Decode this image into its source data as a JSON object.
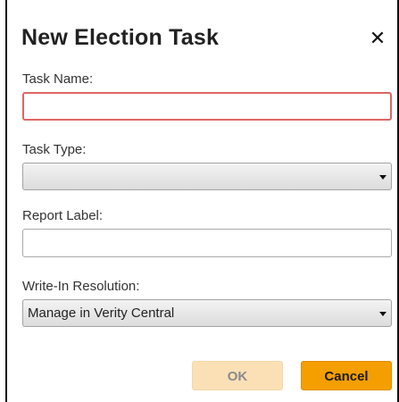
{
  "dialog": {
    "title": "New Election Task",
    "close_glyph": "✕",
    "close_icon": "close-icon"
  },
  "fields": {
    "task_name": {
      "label": "Task Name:",
      "value": "",
      "placeholder": ""
    },
    "task_type": {
      "label": "Task Type:",
      "value": ""
    },
    "report_label": {
      "label": "Report Label:",
      "value": "",
      "placeholder": ""
    },
    "write_in_resolution": {
      "label": "Write-In Resolution:",
      "value": "Manage in Verity Central"
    }
  },
  "buttons": {
    "ok": "OK",
    "cancel": "Cancel"
  },
  "colors": {
    "invalid_border": "#e06666",
    "ok_disabled_bg": "#fbe0b6",
    "cancel_bg": "#f59e00"
  }
}
